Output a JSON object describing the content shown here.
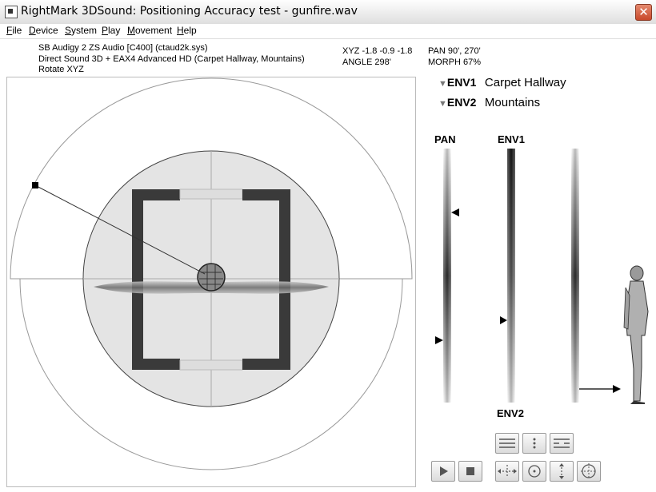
{
  "window": {
    "title": "RightMark 3DSound: Positioning Accuracy test - gunfire.wav",
    "close_glyph": "✕"
  },
  "menu": [
    "File",
    "Device",
    "System",
    "Play",
    "Movement",
    "Help"
  ],
  "device_info": {
    "line1": "SB Audigy 2 ZS Audio [C400] (ctaud2k.sys)",
    "line2": "Direct Sound 3D + EAX4 Advanced HD (Carpet Hallway, Mountains)",
    "line3": "Rotate XYZ"
  },
  "readouts": {
    "xyz": "XYZ  -1.8 -0.9 -1.8",
    "angle": "ANGLE  298'",
    "pan": "PAN   90', 270'",
    "morph": "MORPH   67%"
  },
  "environments": {
    "env1": {
      "tag": "ENV1",
      "name": "Carpet Hallway"
    },
    "env2": {
      "tag": "ENV2",
      "name": "Mountains"
    }
  },
  "sliders": {
    "pan_label": "PAN",
    "env1_label": "ENV1",
    "env2_label": "ENV2"
  },
  "icons": [
    "play-icon",
    "stop-icon",
    "move-horizontal-icon",
    "rotate-icon",
    "move-vertical-icon",
    "orbit-icon",
    "spread-lines-icon",
    "dots-vertical-icon",
    "split-lines-icon"
  ],
  "colors": {
    "frame": "#3a3a3a",
    "circle_fill": "#e4e4e4",
    "close_red": "#c8482a"
  }
}
